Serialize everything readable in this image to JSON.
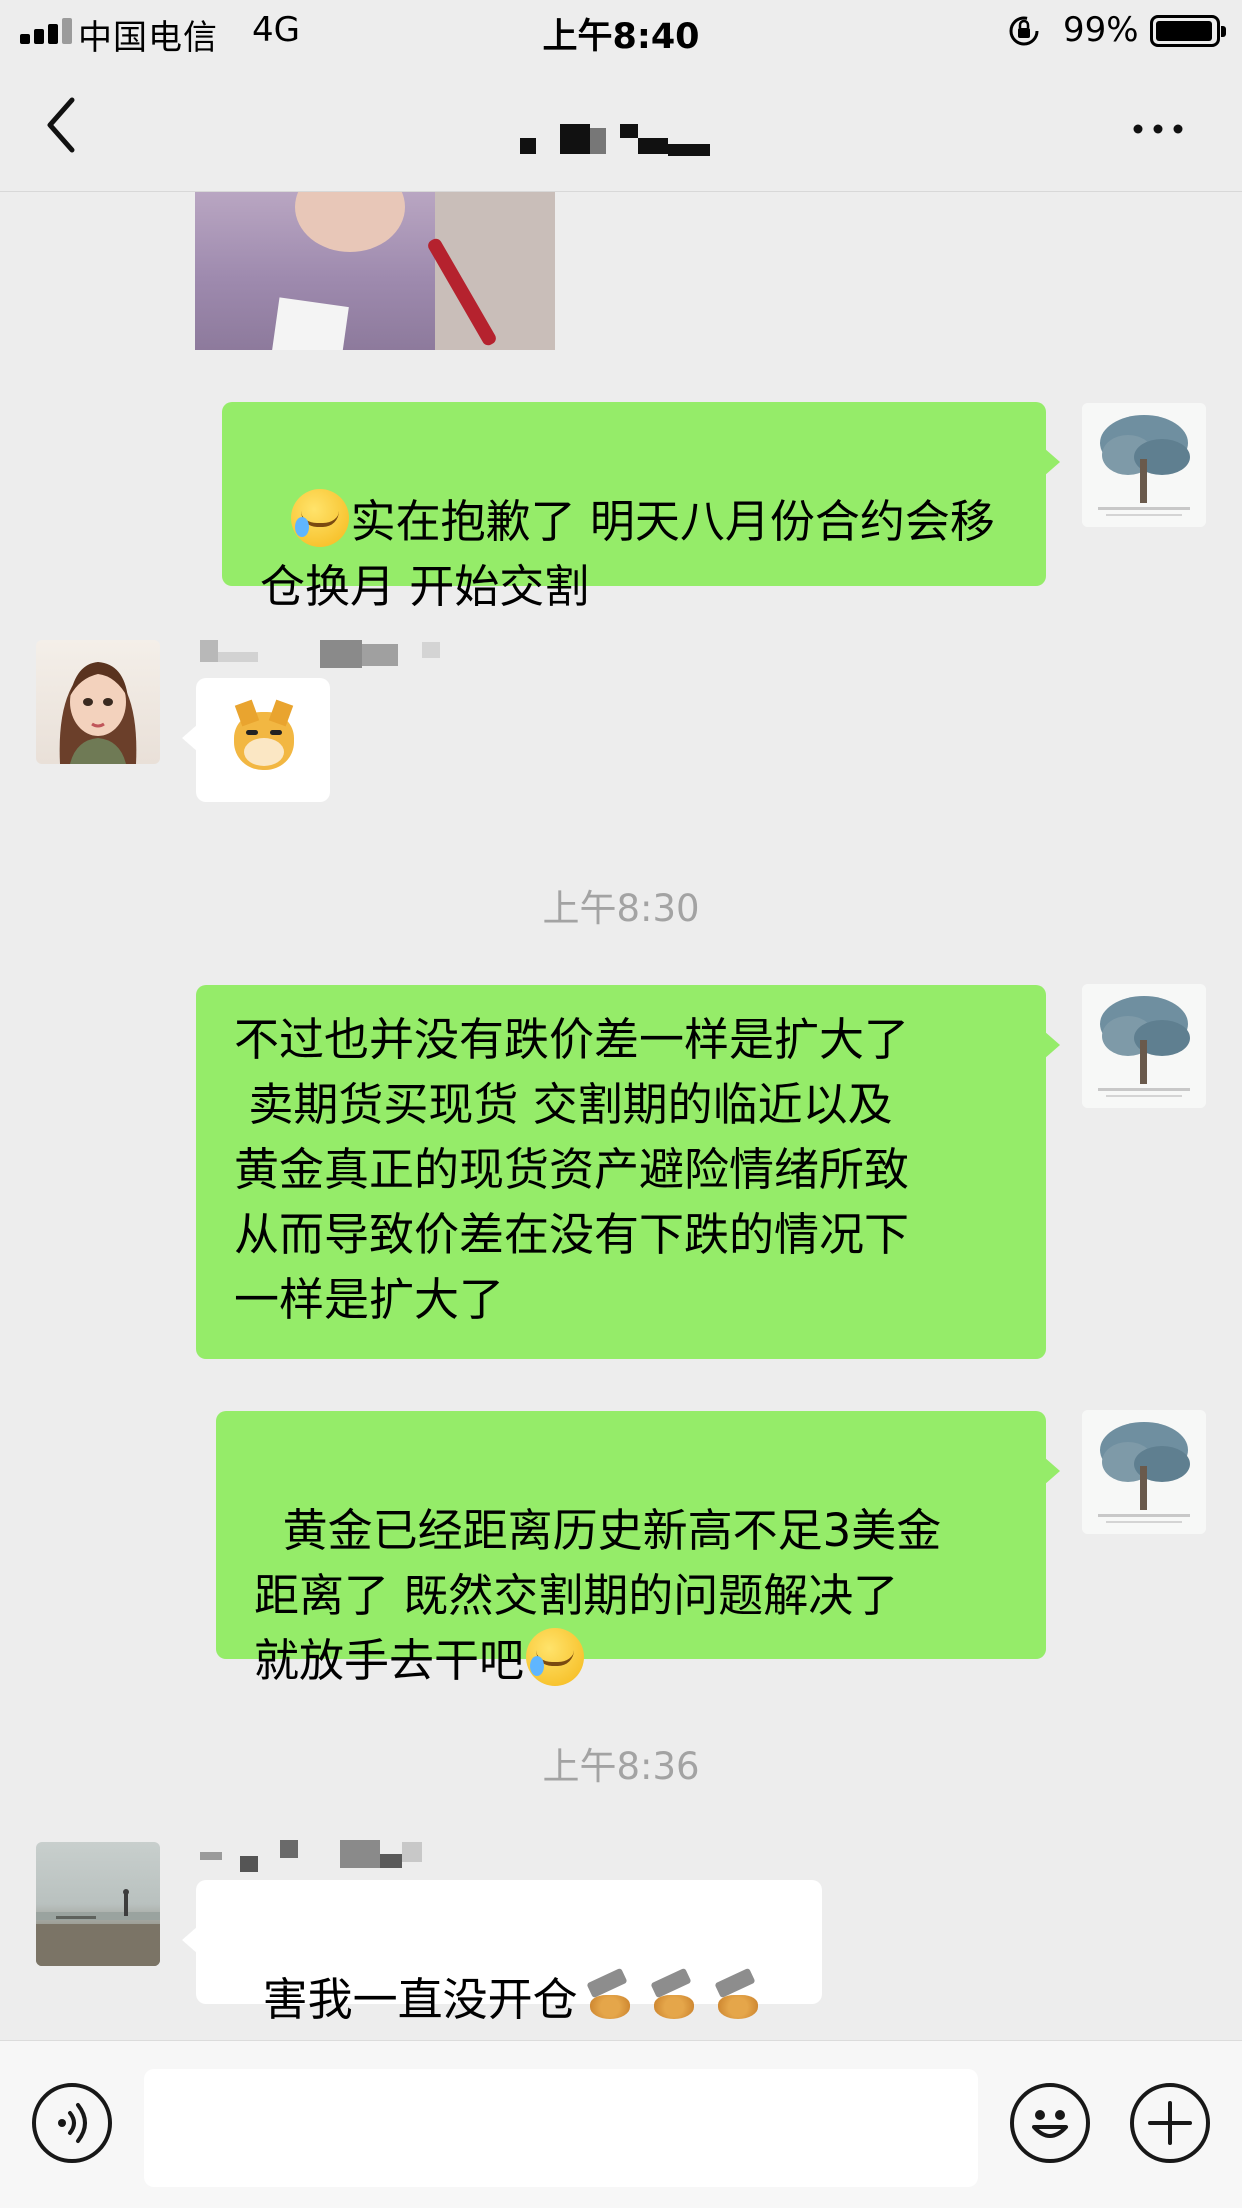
{
  "status_bar": {
    "carrier": "中国电信",
    "network": "4G",
    "time": "上午8:40",
    "battery_percent": "99%",
    "battery_level": 0.99
  },
  "nav": {
    "icons": {
      "back": "chevron-left-icon",
      "more": "more-dots-icon"
    }
  },
  "timestamps": [
    "上午8:30",
    "上午8:36"
  ],
  "messages": {
    "m1": "实在抱歉了 明天八月份合约会移仓换月 开始交割",
    "m3": "不过也并没有跌价差一样是扩大了\n 卖期货买现货 交割期的临近以及\n黄金真正的现货资产避险情绪所致\n从而导致价差在没有下跌的情况下\n一样是扩大了",
    "m4a": "黄金已经距离历史新高不足3美金\n距离了 既然交割期的问题解决了\n就放手去干吧",
    "m5": "害我一直没开仓"
  },
  "input_bar": {
    "placeholder": "",
    "icons": {
      "voice": "voice-icon",
      "emoji": "emoji-icon",
      "plus": "plus-icon"
    }
  },
  "colors": {
    "background": "#ededed",
    "bubble_sent": "#95ec69",
    "bubble_received": "#ffffff",
    "timestamp": "#a3a3a3"
  }
}
